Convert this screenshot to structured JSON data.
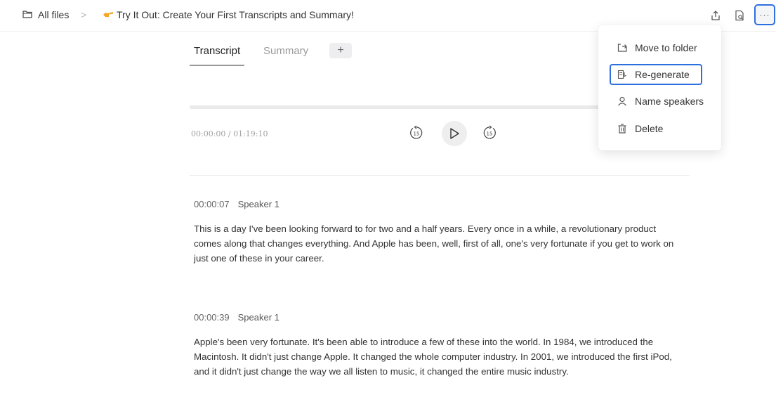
{
  "breadcrumb": {
    "root": "All files",
    "separator": ">",
    "file_title": "Try It Out: Create Your First Transcripts and Summary!"
  },
  "toolbar": {
    "icons": [
      "share-icon",
      "search-document-icon"
    ],
    "more_label": "···"
  },
  "tabs": [
    {
      "label": "Transcript",
      "active": true
    },
    {
      "label": "Summary",
      "active": false
    }
  ],
  "add_tab_label": "+",
  "player": {
    "current_time": "00:00:00",
    "duration": "/ 01:19:10",
    "skip_back_label": "15",
    "skip_forward_label": "15",
    "progress": 0
  },
  "segments": [
    {
      "time": "00:00:07",
      "speaker": "Speaker 1",
      "text": "This is a day I've been looking forward to for two and a half years. Every once in a while, a revolutionary product comes along that changes everything. And Apple has been, well, first of all, one's very fortunate if you get to work on just one of these in your career."
    },
    {
      "time": "00:00:39",
      "speaker": "Speaker 1",
      "text": "Apple's been very fortunate. It's been able to introduce a few of these into the world. In 1984, we introduced the Macintosh. It didn't just change Apple. It changed the whole computer industry. In 2001, we introduced the first iPod, and it didn't just change the way we all listen to music, it changed the entire music industry."
    }
  ],
  "menu": {
    "items": [
      {
        "label": "Move to folder",
        "icon": "move-folder-icon"
      },
      {
        "label": "Re-generate",
        "icon": "regenerate-icon",
        "highlighted": true
      },
      {
        "label": "Name speakers",
        "icon": "person-icon"
      },
      {
        "label": "Delete",
        "icon": "trash-icon"
      }
    ]
  },
  "colors": {
    "highlight": "#2e6fe0",
    "point_emoji": "#f5a623"
  }
}
